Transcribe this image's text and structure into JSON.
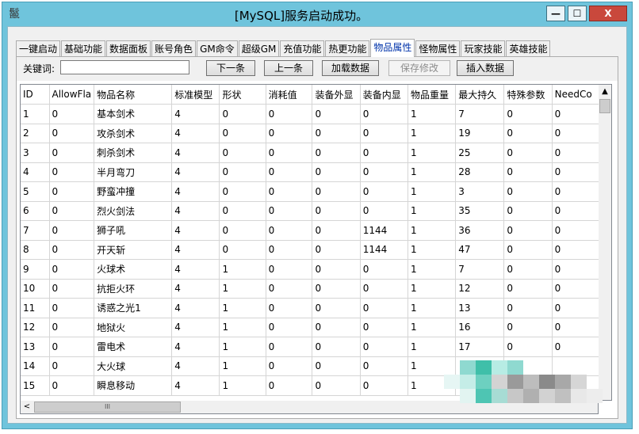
{
  "window": {
    "title": "[MySQL]服务启动成功。",
    "app_icon": "鬣",
    "min_label": "—",
    "max_label": "☐",
    "close_label": "X"
  },
  "tabs": [
    "一键启动",
    "基础功能",
    "数据面板",
    "账号角色",
    "GM命令",
    "超级GM",
    "充值功能",
    "热更功能",
    "物品属性",
    "怪物属性",
    "玩家技能",
    "英雄技能"
  ],
  "active_tab": "物品属性",
  "search": {
    "label": "关键词:",
    "value": "",
    "next_label": "下一条",
    "prev_label": "上一条",
    "load_label": "加载数据",
    "save_label": "保存修改",
    "insert_label": "插入数据"
  },
  "table": {
    "columns": [
      "ID",
      "AllowFla",
      "物品名称",
      "标准模型",
      "形状",
      "消耗值",
      "装备外显",
      "装备内显",
      "物品重量",
      "最大持久",
      "特殊参数",
      "NeedCo"
    ],
    "rows": [
      [
        "1",
        "0",
        "基本剑术",
        "4",
        "0",
        "0",
        "0",
        "0",
        "1",
        "7",
        "0",
        "0"
      ],
      [
        "2",
        "0",
        "攻杀剑术",
        "4",
        "0",
        "0",
        "0",
        "0",
        "1",
        "19",
        "0",
        "0"
      ],
      [
        "3",
        "0",
        "刺杀剑术",
        "4",
        "0",
        "0",
        "0",
        "0",
        "1",
        "25",
        "0",
        "0"
      ],
      [
        "4",
        "0",
        "半月弯刀",
        "4",
        "0",
        "0",
        "0",
        "0",
        "1",
        "28",
        "0",
        "0"
      ],
      [
        "5",
        "0",
        "野蛮冲撞",
        "4",
        "0",
        "0",
        "0",
        "0",
        "1",
        "3",
        "0",
        "0"
      ],
      [
        "6",
        "0",
        "烈火剑法",
        "4",
        "0",
        "0",
        "0",
        "0",
        "1",
        "35",
        "0",
        "0"
      ],
      [
        "7",
        "0",
        "狮子吼",
        "4",
        "0",
        "0",
        "0",
        "1144",
        "1",
        "36",
        "0",
        "0"
      ],
      [
        "8",
        "0",
        "开天斩",
        "4",
        "0",
        "0",
        "0",
        "1144",
        "1",
        "47",
        "0",
        "0"
      ],
      [
        "9",
        "0",
        "火球术",
        "4",
        "1",
        "0",
        "0",
        "0",
        "1",
        "7",
        "0",
        "0"
      ],
      [
        "10",
        "0",
        "抗拒火环",
        "4",
        "1",
        "0",
        "0",
        "0",
        "1",
        "12",
        "0",
        "0"
      ],
      [
        "11",
        "0",
        "诱惑之光1",
        "4",
        "1",
        "0",
        "0",
        "0",
        "1",
        "13",
        "0",
        "0"
      ],
      [
        "12",
        "0",
        "地狱火",
        "4",
        "1",
        "0",
        "0",
        "0",
        "1",
        "16",
        "0",
        "0"
      ],
      [
        "13",
        "0",
        "雷电术",
        "4",
        "1",
        "0",
        "0",
        "0",
        "1",
        "17",
        "0",
        "0"
      ],
      [
        "14",
        "0",
        "大火球",
        "4",
        "1",
        "0",
        "0",
        "0",
        "1",
        "",
        "",
        ""
      ],
      [
        "15",
        "0",
        "瞬息移动",
        "4",
        "1",
        "0",
        "0",
        "0",
        "1",
        "",
        "",
        ""
      ]
    ]
  },
  "scrollbar": {
    "up_arrow": "▲",
    "left_arrow": "<",
    "thumb_grip": "III"
  }
}
